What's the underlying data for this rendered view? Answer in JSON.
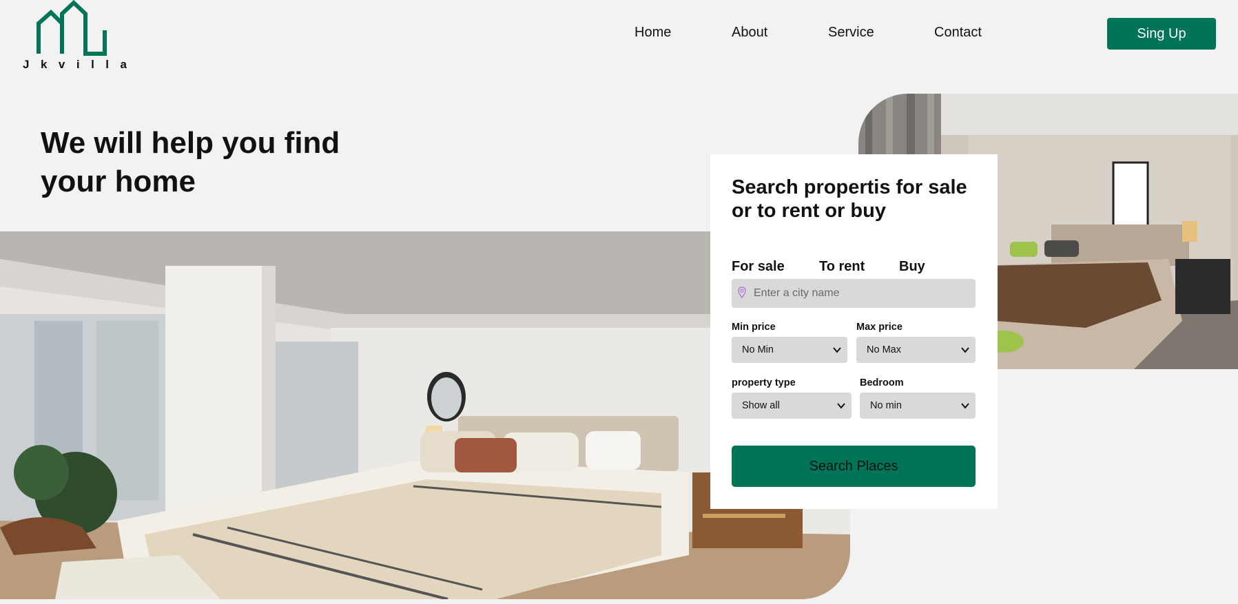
{
  "brand": {
    "name": "Jkvilla",
    "color": "#007456",
    "logo_icon": "house-outline-logo-icon"
  },
  "nav": {
    "items": [
      {
        "label": "Home"
      },
      {
        "label": "About"
      },
      {
        "label": "Service"
      },
      {
        "label": "Contact"
      }
    ]
  },
  "signup": {
    "label": "Sing Up"
  },
  "hero": {
    "title": "We will help you find your home"
  },
  "search": {
    "title": "Search propertis for sale or to rent or buy",
    "tabs": [
      {
        "label": "For sale"
      },
      {
        "label": "To rent"
      },
      {
        "label": "Buy"
      }
    ],
    "city": {
      "placeholder": "Enter a city name",
      "value": "",
      "icon": "location-pin-icon"
    },
    "min_price": {
      "label": "Min price",
      "selected": "No Min"
    },
    "max_price": {
      "label": "Max price",
      "selected": "No Max"
    },
    "property_type": {
      "label": "property type",
      "selected": "Show all"
    },
    "bedroom": {
      "label": "Bedroom",
      "selected": "No min"
    },
    "button": {
      "label": "Search Places"
    }
  },
  "images": {
    "main": "bedroom-photo",
    "side": "bedroom-photo"
  }
}
